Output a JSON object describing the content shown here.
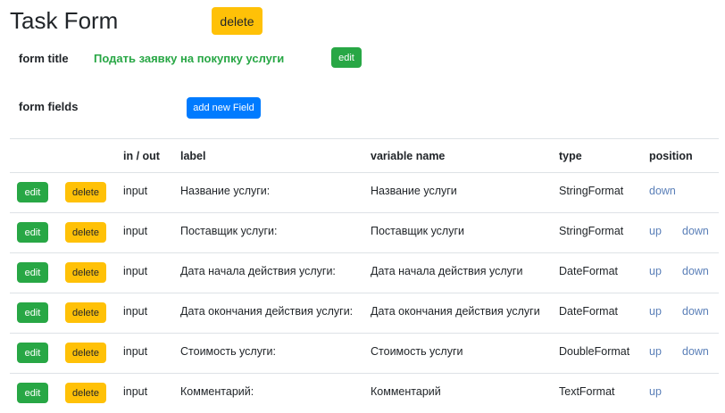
{
  "page": {
    "title": "Task Form",
    "delete_label": "delete"
  },
  "form_title": {
    "label": "form title",
    "value": "Подать заявку на покупку услуги",
    "edit_label": "edit"
  },
  "form_fields": {
    "label": "form fields",
    "add_label": "add new Field"
  },
  "table": {
    "headers": [
      "",
      "",
      "in / out",
      "label",
      "variable name",
      "type",
      "position"
    ],
    "edit_label": "edit",
    "delete_label": "delete",
    "up_label": "up",
    "down_label": "down",
    "rows": [
      {
        "io": "input",
        "label": "Название услуги:",
        "variable": "Название услуги",
        "type": "StringFormat"
      },
      {
        "io": "input",
        "label": "Поставщик услуги:",
        "variable": "Поставщик услуги",
        "type": "StringFormat"
      },
      {
        "io": "input",
        "label": "Дата начала действия услуги:",
        "variable": "Дата начала действия услуги",
        "type": "DateFormat"
      },
      {
        "io": "input",
        "label": "Дата окончания действия услуги:",
        "variable": "Дата окончания действия услуги",
        "type": "DateFormat"
      },
      {
        "io": "input",
        "label": "Стоимость услуги:",
        "variable": "Стоимость услуги",
        "type": "DoubleFormat"
      },
      {
        "io": "input",
        "label": "Комментарий:",
        "variable": "Комментарий",
        "type": "TextFormat"
      }
    ]
  },
  "colors": {
    "success": "#28a745",
    "warning": "#ffc107",
    "primary": "#007bff",
    "link": "#5a7fb8"
  }
}
